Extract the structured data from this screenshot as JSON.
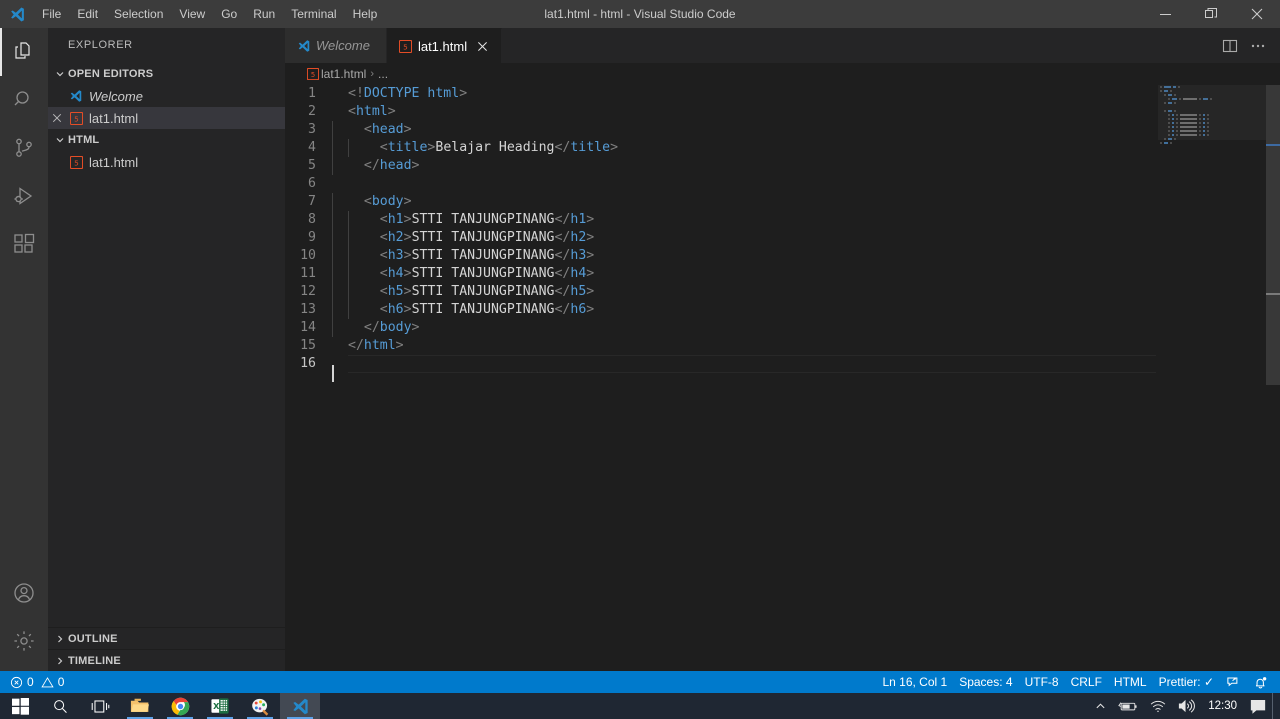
{
  "window": {
    "title": "lat1.html - html - Visual Studio Code",
    "menu": [
      "File",
      "Edit",
      "Selection",
      "View",
      "Go",
      "Run",
      "Terminal",
      "Help"
    ],
    "controls": {
      "minimize": "minimize-icon",
      "restore": "restore-icon",
      "close": "close-icon"
    }
  },
  "activitybar": {
    "items": [
      {
        "name": "explorer",
        "icon": "files-icon",
        "active": true
      },
      {
        "name": "search",
        "icon": "search-icon",
        "active": false
      },
      {
        "name": "source-control",
        "icon": "source-control-icon",
        "active": false
      },
      {
        "name": "run-and-debug",
        "icon": "run-debug-icon",
        "active": false
      },
      {
        "name": "extensions",
        "icon": "extensions-icon",
        "active": false
      }
    ],
    "bottom": [
      {
        "name": "accounts",
        "icon": "account-icon"
      },
      {
        "name": "manage",
        "icon": "gear-icon"
      }
    ]
  },
  "sidebar": {
    "title": "EXPLORER",
    "sections": [
      {
        "label": "OPEN EDITORS",
        "expanded": true,
        "items": [
          {
            "label": "Welcome",
            "icon": "vscode-icon",
            "italic": true,
            "selected": false,
            "closable": false
          },
          {
            "label": "lat1.html",
            "icon": "html5-icon",
            "italic": false,
            "selected": true,
            "closable": true
          }
        ]
      },
      {
        "label": "HTML",
        "expanded": true,
        "items": [
          {
            "label": "lat1.html",
            "icon": "html5-icon",
            "italic": false,
            "selected": false,
            "closable": false
          }
        ]
      }
    ],
    "collapsed_sections": [
      {
        "label": "OUTLINE"
      },
      {
        "label": "TIMELINE"
      }
    ]
  },
  "editor": {
    "tabs": [
      {
        "label": "Welcome",
        "icon": "vscode-icon",
        "italic": true,
        "active": false,
        "closable": false
      },
      {
        "label": "lat1.html",
        "icon": "html5-icon",
        "italic": false,
        "active": true,
        "closable": true
      }
    ],
    "tab_actions": [
      {
        "name": "split-editor-right",
        "icon": "split-editor-icon"
      },
      {
        "name": "more-actions",
        "icon": "ellipsis-icon"
      }
    ],
    "breadcrumb": {
      "file": "lat1.html",
      "separator": "›",
      "trail": "..."
    },
    "lines": [
      {
        "n": 1,
        "indent": 0,
        "tokens": [
          {
            "t": "brk",
            "v": "<!"
          },
          {
            "t": "dt",
            "v": "DOCTYPE"
          },
          {
            "t": "txt",
            "v": " "
          },
          {
            "t": "tag",
            "v": "html"
          },
          {
            "t": "brk",
            "v": ">"
          }
        ]
      },
      {
        "n": 2,
        "indent": 0,
        "tokens": [
          {
            "t": "brk",
            "v": "<"
          },
          {
            "t": "tag",
            "v": "html"
          },
          {
            "t": "brk",
            "v": ">"
          }
        ]
      },
      {
        "n": 3,
        "indent": 1,
        "tokens": [
          {
            "t": "txt",
            "v": "  "
          },
          {
            "t": "brk",
            "v": "<"
          },
          {
            "t": "tag",
            "v": "head"
          },
          {
            "t": "brk",
            "v": ">"
          }
        ]
      },
      {
        "n": 4,
        "indent": 2,
        "tokens": [
          {
            "t": "txt",
            "v": "    "
          },
          {
            "t": "brk",
            "v": "<"
          },
          {
            "t": "tag",
            "v": "title"
          },
          {
            "t": "brk",
            "v": ">"
          },
          {
            "t": "txt",
            "v": "Belajar Heading"
          },
          {
            "t": "brk",
            "v": "</"
          },
          {
            "t": "tag",
            "v": "title"
          },
          {
            "t": "brk",
            "v": ">"
          }
        ]
      },
      {
        "n": 5,
        "indent": 1,
        "tokens": [
          {
            "t": "txt",
            "v": "  "
          },
          {
            "t": "brk",
            "v": "</"
          },
          {
            "t": "tag",
            "v": "head"
          },
          {
            "t": "brk",
            "v": ">"
          }
        ]
      },
      {
        "n": 6,
        "indent": 0,
        "tokens": []
      },
      {
        "n": 7,
        "indent": 1,
        "tokens": [
          {
            "t": "txt",
            "v": "  "
          },
          {
            "t": "brk",
            "v": "<"
          },
          {
            "t": "tag",
            "v": "body"
          },
          {
            "t": "brk",
            "v": ">"
          }
        ]
      },
      {
        "n": 8,
        "indent": 2,
        "tokens": [
          {
            "t": "txt",
            "v": "    "
          },
          {
            "t": "brk",
            "v": "<"
          },
          {
            "t": "tag",
            "v": "h1"
          },
          {
            "t": "brk",
            "v": ">"
          },
          {
            "t": "txt",
            "v": "STTI TANJUNGPINANG"
          },
          {
            "t": "brk",
            "v": "</"
          },
          {
            "t": "tag",
            "v": "h1"
          },
          {
            "t": "brk",
            "v": ">"
          }
        ]
      },
      {
        "n": 9,
        "indent": 2,
        "tokens": [
          {
            "t": "txt",
            "v": "    "
          },
          {
            "t": "brk",
            "v": "<"
          },
          {
            "t": "tag",
            "v": "h2"
          },
          {
            "t": "brk",
            "v": ">"
          },
          {
            "t": "txt",
            "v": "STTI TANJUNGPINANG"
          },
          {
            "t": "brk",
            "v": "</"
          },
          {
            "t": "tag",
            "v": "h2"
          },
          {
            "t": "brk",
            "v": ">"
          }
        ]
      },
      {
        "n": 10,
        "indent": 2,
        "tokens": [
          {
            "t": "txt",
            "v": "    "
          },
          {
            "t": "brk",
            "v": "<"
          },
          {
            "t": "tag",
            "v": "h3"
          },
          {
            "t": "brk",
            "v": ">"
          },
          {
            "t": "txt",
            "v": "STTI TANJUNGPINANG"
          },
          {
            "t": "brk",
            "v": "</"
          },
          {
            "t": "tag",
            "v": "h3"
          },
          {
            "t": "brk",
            "v": ">"
          }
        ]
      },
      {
        "n": 11,
        "indent": 2,
        "tokens": [
          {
            "t": "txt",
            "v": "    "
          },
          {
            "t": "brk",
            "v": "<"
          },
          {
            "t": "tag",
            "v": "h4"
          },
          {
            "t": "brk",
            "v": ">"
          },
          {
            "t": "txt",
            "v": "STTI TANJUNGPINANG"
          },
          {
            "t": "brk",
            "v": "</"
          },
          {
            "t": "tag",
            "v": "h4"
          },
          {
            "t": "brk",
            "v": ">"
          }
        ]
      },
      {
        "n": 12,
        "indent": 2,
        "tokens": [
          {
            "t": "txt",
            "v": "    "
          },
          {
            "t": "brk",
            "v": "<"
          },
          {
            "t": "tag",
            "v": "h5"
          },
          {
            "t": "brk",
            "v": ">"
          },
          {
            "t": "txt",
            "v": "STTI TANJUNGPINANG"
          },
          {
            "t": "brk",
            "v": "</"
          },
          {
            "t": "tag",
            "v": "h5"
          },
          {
            "t": "brk",
            "v": ">"
          }
        ]
      },
      {
        "n": 13,
        "indent": 2,
        "tokens": [
          {
            "t": "txt",
            "v": "    "
          },
          {
            "t": "brk",
            "v": "<"
          },
          {
            "t": "tag",
            "v": "h6"
          },
          {
            "t": "brk",
            "v": ">"
          },
          {
            "t": "txt",
            "v": "STTI TANJUNGPINANG"
          },
          {
            "t": "brk",
            "v": "</"
          },
          {
            "t": "tag",
            "v": "h6"
          },
          {
            "t": "brk",
            "v": ">"
          }
        ]
      },
      {
        "n": 14,
        "indent": 1,
        "tokens": [
          {
            "t": "txt",
            "v": "  "
          },
          {
            "t": "brk",
            "v": "</"
          },
          {
            "t": "tag",
            "v": "body"
          },
          {
            "t": "brk",
            "v": ">"
          }
        ]
      },
      {
        "n": 15,
        "indent": 0,
        "tokens": [
          {
            "t": "brk",
            "v": "</"
          },
          {
            "t": "tag",
            "v": "html"
          },
          {
            "t": "brk",
            "v": ">"
          }
        ]
      },
      {
        "n": 16,
        "indent": 0,
        "tokens": [],
        "current": true
      }
    ],
    "cursor": {
      "line": 16,
      "column": 1
    }
  },
  "statusbar": {
    "errors": "0",
    "warnings": "0",
    "items": [
      {
        "name": "editor-position",
        "label": "Ln 16, Col 1"
      },
      {
        "name": "editor-indentation",
        "label": "Spaces: 4"
      },
      {
        "name": "editor-encoding",
        "label": "UTF-8"
      },
      {
        "name": "editor-eol",
        "label": "CRLF"
      },
      {
        "name": "editor-language",
        "label": "HTML"
      },
      {
        "name": "prettier-status",
        "label": "Prettier: ✓"
      }
    ],
    "right_icons": [
      {
        "name": "remote-window-icon"
      },
      {
        "name": "notifications-bell-icon"
      }
    ],
    "accent": "#007acc"
  },
  "taskbar": {
    "buttons": [
      {
        "name": "start-button",
        "icon": "windows-logo-icon",
        "running": false,
        "active": false
      },
      {
        "name": "search-button",
        "icon": "search-icon",
        "running": false,
        "active": false
      },
      {
        "name": "task-view-button",
        "icon": "task-view-icon",
        "running": false,
        "active": false
      },
      {
        "name": "file-explorer",
        "icon": "folder-icon",
        "running": true,
        "active": false
      },
      {
        "name": "google-chrome",
        "icon": "chrome-icon",
        "running": true,
        "active": false
      },
      {
        "name": "microsoft-excel",
        "icon": "excel-icon",
        "running": true,
        "active": false
      },
      {
        "name": "paint-3d",
        "icon": "paint-icon",
        "running": true,
        "active": false
      },
      {
        "name": "visual-studio-code",
        "icon": "vscode-icon",
        "running": true,
        "active": true
      }
    ],
    "tray": {
      "chevron": "show-hidden-icons",
      "icons": [
        "battery-icon",
        "wifi-icon",
        "volume-icon"
      ],
      "clock": "12:30",
      "action_center": "notification-icon"
    }
  }
}
